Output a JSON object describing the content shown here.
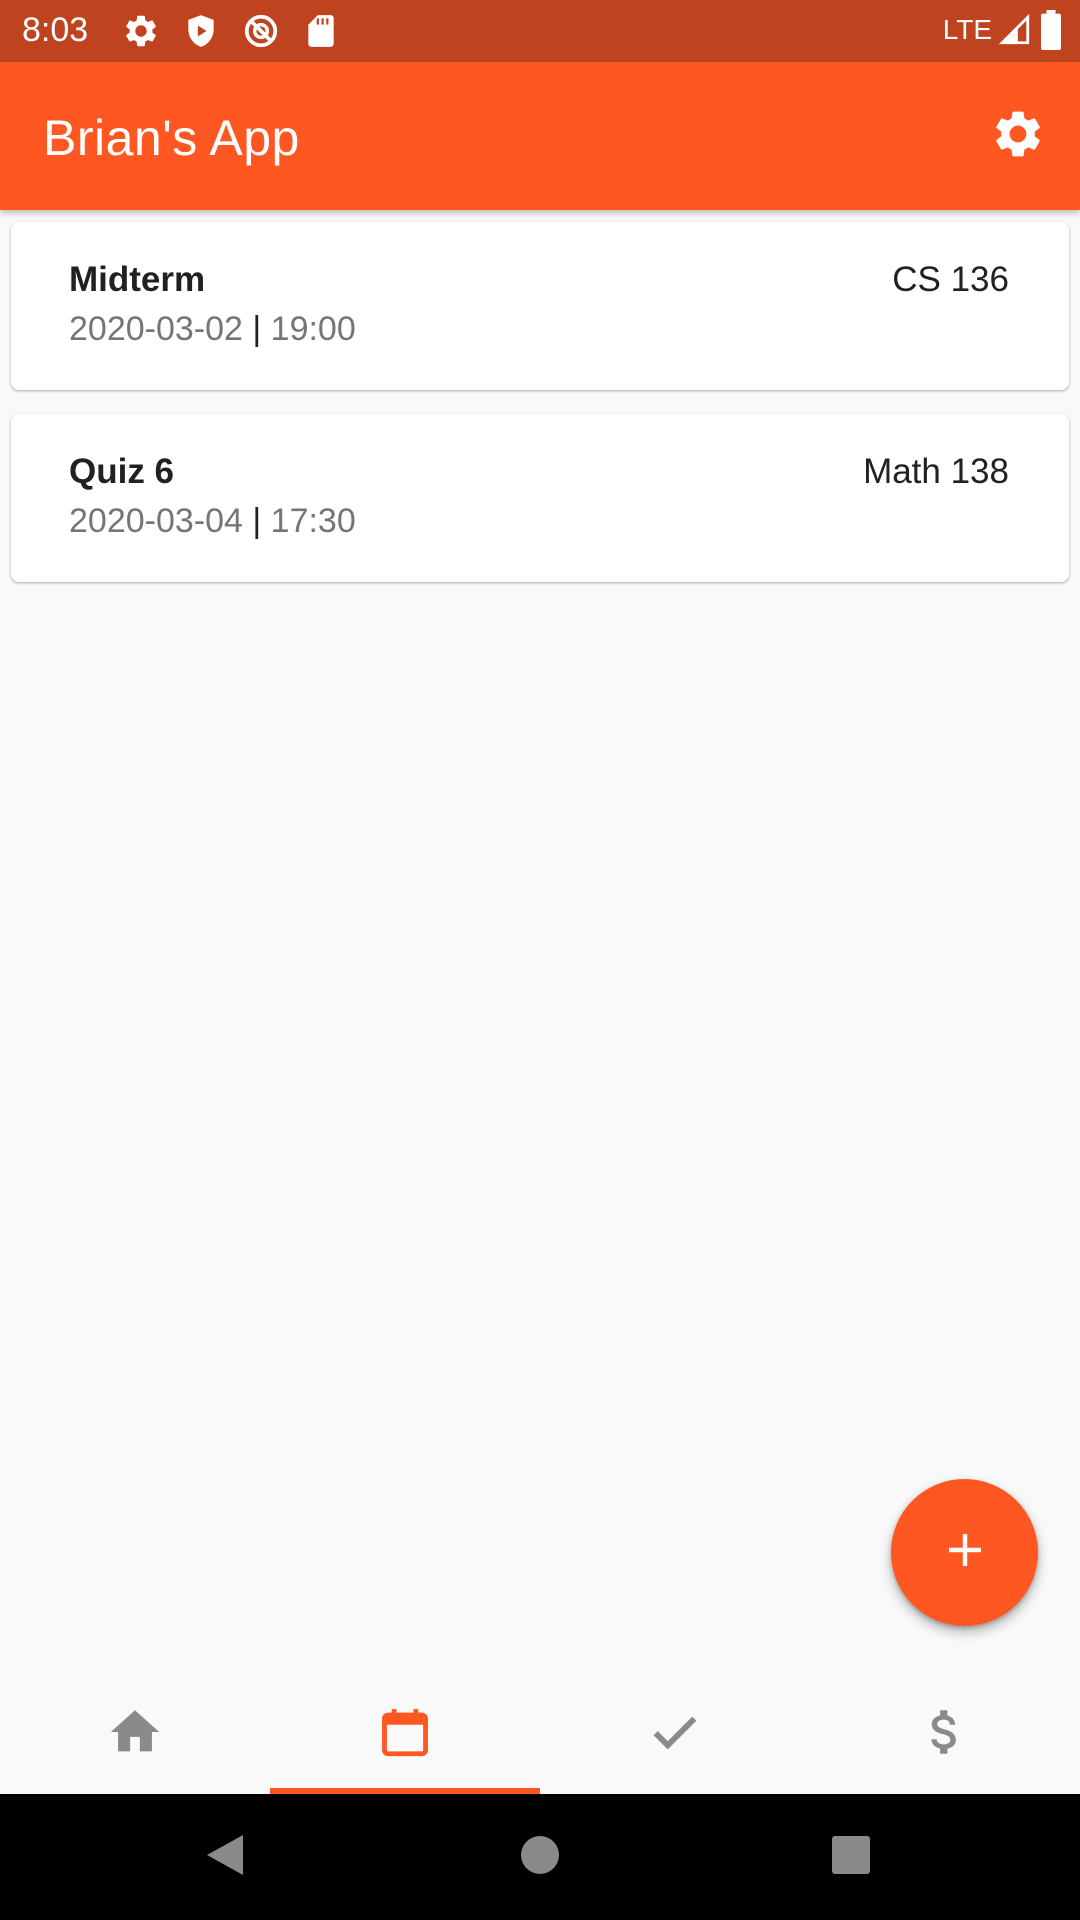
{
  "status_bar": {
    "time": "8:03",
    "network": "LTE",
    "icons": [
      "settings-icon",
      "shield-play-icon",
      "blocked-sync-icon",
      "sd-card-icon",
      "signal-icon",
      "battery-icon"
    ]
  },
  "app_bar": {
    "title": "Brian's App",
    "background": "#ff5722",
    "action_icon": "gear-icon"
  },
  "events": [
    {
      "title": "Midterm",
      "course": "CS 136",
      "date": "2020-03-02",
      "separator": "|",
      "time": "19:00"
    },
    {
      "title": "Quiz 6",
      "course": "Math 138",
      "date": "2020-03-04",
      "separator": "|",
      "time": "17:30"
    }
  ],
  "fab": {
    "icon": "plus-icon",
    "color": "#ff5722"
  },
  "bottom_nav": {
    "tabs": [
      {
        "icon": "home-icon",
        "selected": false
      },
      {
        "icon": "calendar-icon",
        "selected": true
      },
      {
        "icon": "check-icon",
        "selected": false
      },
      {
        "icon": "dollar-icon",
        "selected": false
      }
    ],
    "active_color": "#ff5722",
    "inactive_color": "#8a8a8a"
  },
  "system_nav": {
    "icons": [
      "back-icon",
      "home-circle-icon",
      "recents-icon"
    ]
  }
}
